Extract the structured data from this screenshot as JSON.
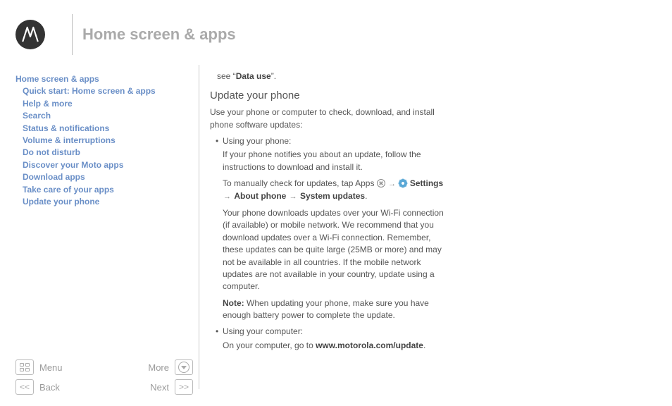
{
  "header": {
    "title": "Home screen & apps"
  },
  "sidebar": {
    "head": "Home screen & apps",
    "items": [
      "Quick start: Home screen & apps",
      "Help & more",
      "Search",
      "Status & notifications",
      "Volume & interruptions",
      "Do not disturb",
      "Discover your Moto apps",
      "Download apps",
      "Take care of your apps",
      "Update your phone"
    ]
  },
  "content": {
    "carry_pre": "see “",
    "carry_bold": "Data use",
    "carry_post": "”.",
    "h3": "Update your phone",
    "intro": "Use your phone or computer to check, download, and install phone software updates:",
    "b1_head": "Using your phone:",
    "b1_p1": "If your phone notifies you about an update, follow the instructions to download and install it.",
    "b1_p2_pre": "To manually check for updates, tap Apps ",
    "b1_p2_settings": "Settings",
    "b1_p2_about": "About phone",
    "b1_p2_system": "System updates",
    "b1_p3": "Your phone downloads updates over your Wi-Fi connection (if available) or mobile network. We recommend that you download updates over a Wi-Fi connection. Remember, these updates can be quite large (25MB or more) and may not be available in all countries. If the mobile network updates are not available in your country, update using a computer.",
    "b1_note_label": "Note:",
    "b1_note": " When updating your phone, make sure you have enough battery power to complete the update.",
    "b2_head": "Using your computer:",
    "b2_p1_pre": "On your computer, go to ",
    "b2_p1_link": "www.motorola.com/update",
    "b2_p1_post": "."
  },
  "footer": {
    "menu": "Menu",
    "more": "More",
    "back": "Back",
    "next": "Next"
  }
}
